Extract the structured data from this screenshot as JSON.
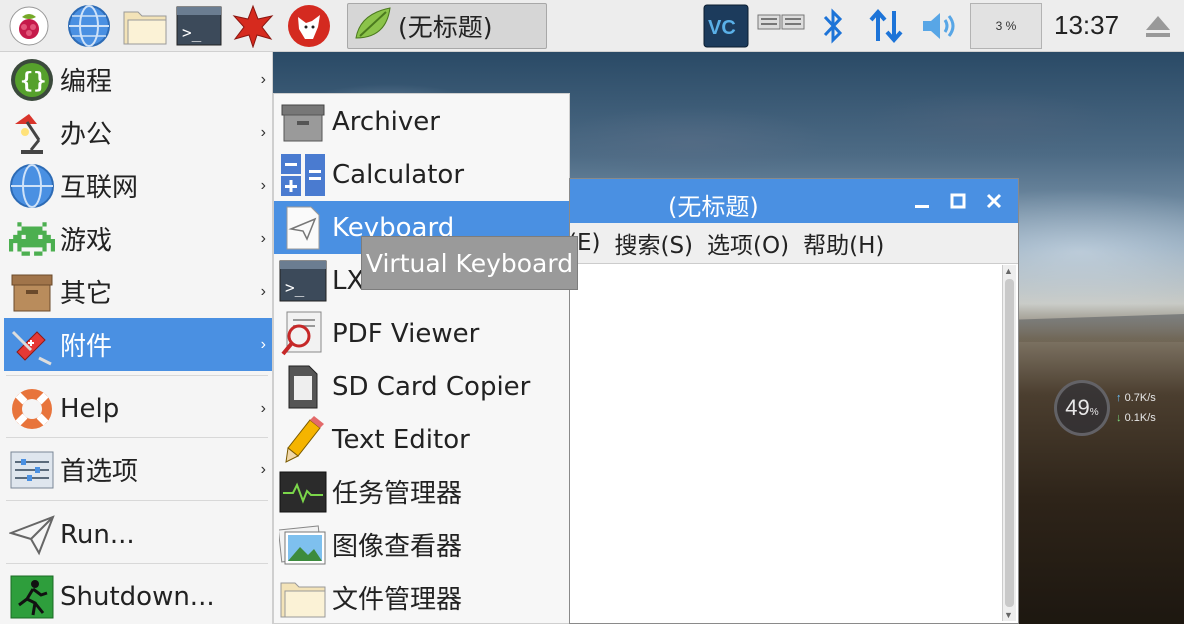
{
  "panel": {
    "task_title": "(无标题)",
    "cpu_usage": "3 %",
    "clock": "13:37"
  },
  "main_menu": {
    "items": [
      {
        "label": "编程",
        "icon": "programming-icon",
        "has_submenu": true
      },
      {
        "label": "办公",
        "icon": "office-lamp-icon",
        "has_submenu": true
      },
      {
        "label": "互联网",
        "icon": "globe-icon",
        "has_submenu": true
      },
      {
        "label": "游戏",
        "icon": "space-invader-icon",
        "has_submenu": true
      },
      {
        "label": "其它",
        "icon": "box-icon",
        "has_submenu": true
      },
      {
        "label": "附件",
        "icon": "swiss-knife-icon",
        "has_submenu": true,
        "active": true
      },
      {
        "label": "Help",
        "icon": "lifebuoy-icon",
        "has_submenu": true
      },
      {
        "label": "首选项",
        "icon": "preferences-icon",
        "has_submenu": true
      },
      {
        "label": "Run...",
        "icon": "paper-plane-icon",
        "has_submenu": false
      },
      {
        "label": "Shutdown...",
        "icon": "exit-icon",
        "has_submenu": false
      }
    ],
    "arrow": "›"
  },
  "submenu": {
    "items": [
      {
        "label": "Archiver",
        "icon": "archiver-icon"
      },
      {
        "label": "Calculator",
        "icon": "calculator-icon"
      },
      {
        "label": "Keyboard",
        "icon": "keyboard-icon",
        "active": true
      },
      {
        "label": "LX",
        "icon": "terminal-icon"
      },
      {
        "label": "PDF Viewer",
        "icon": "pdf-viewer-icon"
      },
      {
        "label": "SD Card Copier",
        "icon": "sd-card-icon"
      },
      {
        "label": "Text Editor",
        "icon": "pencil-icon"
      },
      {
        "label": "任务管理器",
        "icon": "task-manager-icon"
      },
      {
        "label": "图像查看器",
        "icon": "image-viewer-icon"
      },
      {
        "label": "文件管理器",
        "icon": "folder-icon"
      }
    ]
  },
  "tooltip": {
    "text": "Virtual Keyboard"
  },
  "editor": {
    "title": "(无标题)",
    "menu": [
      "(E)",
      "搜索(S)",
      "选项(O)",
      "帮助(H)"
    ]
  },
  "netwidget": {
    "percent": "49",
    "percent_unit": "%",
    "up": "0.7",
    "down": "0.1",
    "speed_unit": "K/s"
  },
  "colors": {
    "accent": "#4a90e2",
    "panel_bg": "#ededed",
    "menu_bg": "#f5f5f5"
  }
}
